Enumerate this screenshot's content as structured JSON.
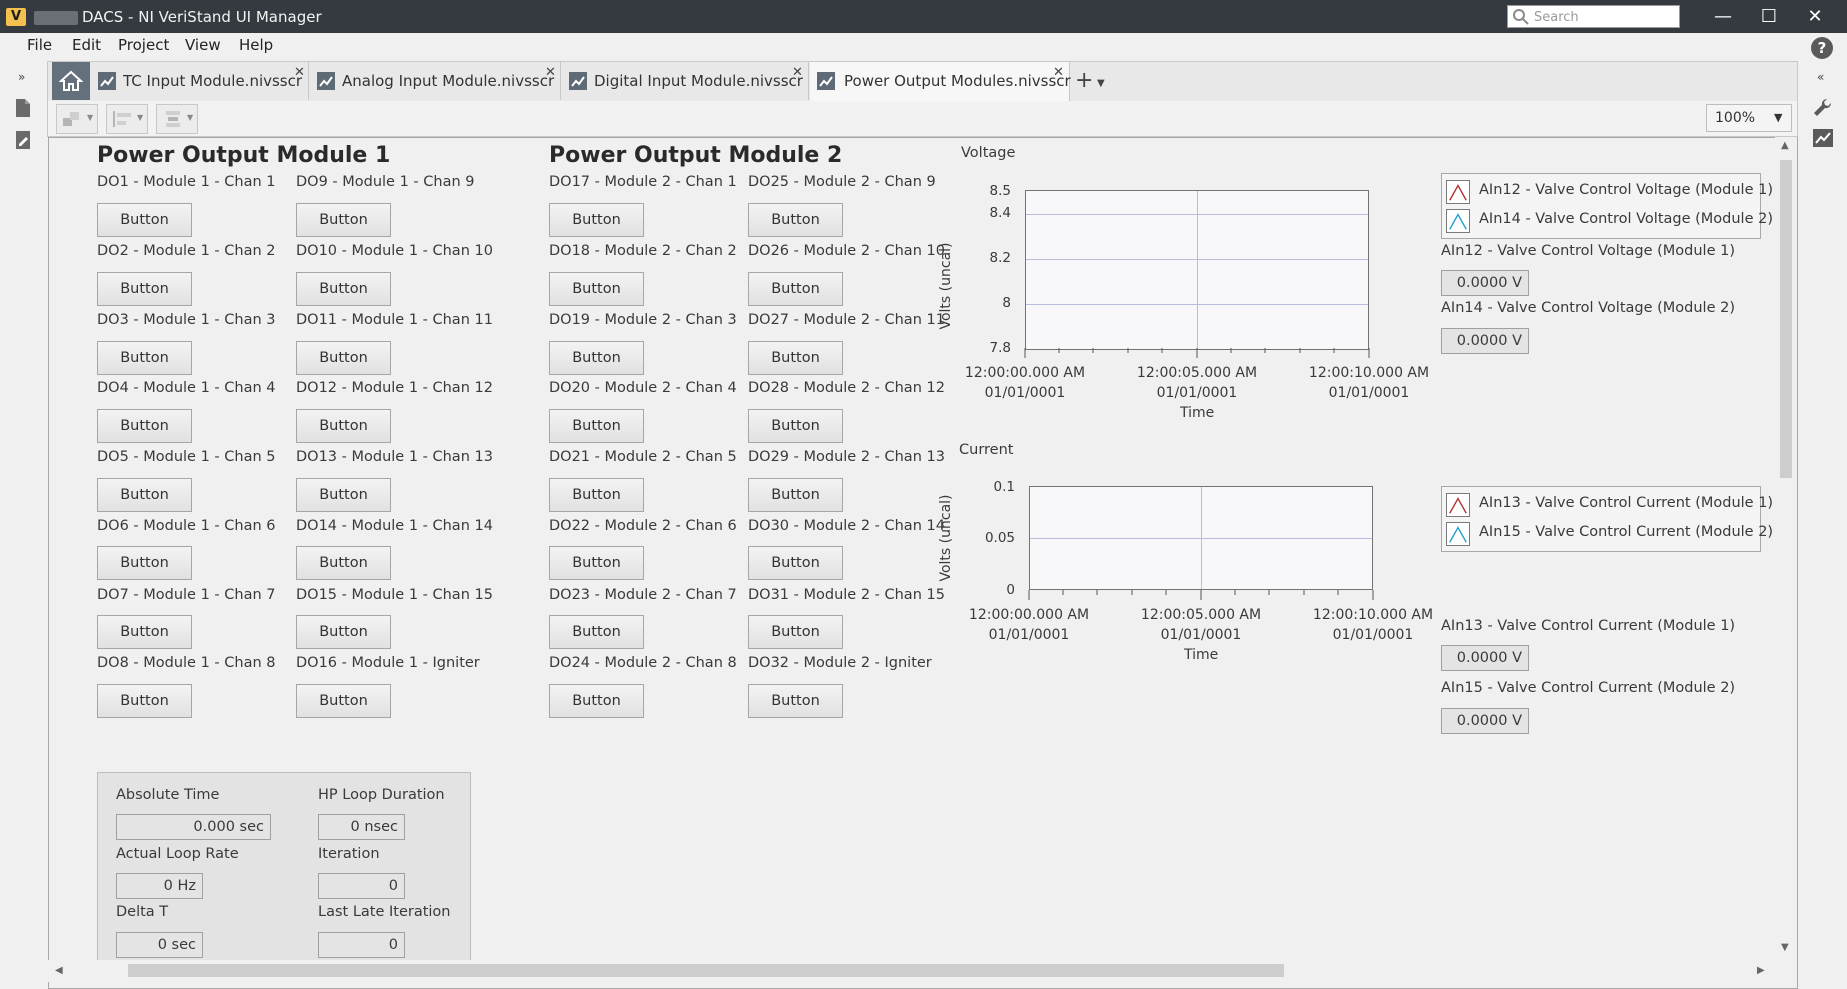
{
  "window": {
    "app_logo": "V",
    "title": "DACS - NI VeriStand UI Manager",
    "search_placeholder": "Search"
  },
  "menu": [
    "File",
    "Edit",
    "Project",
    "View",
    "Help"
  ],
  "tabs": [
    {
      "label": "TC Input Module.nivsscr"
    },
    {
      "label": "Analog Input Module.nivsscr"
    },
    {
      "label": "Digital Input Module.nivsscr"
    },
    {
      "label": "Power Output Modules.nivsscr"
    }
  ],
  "toolbar": {
    "zoom": "100%"
  },
  "module1": {
    "title": "Power Output Module 1",
    "channels": [
      "DO1 - Module 1 - Chan 1",
      "DO2 - Module 1 - Chan 2",
      "DO3 - Module 1 - Chan 3",
      "DO4 - Module 1 - Chan 4",
      "DO5 - Module 1 - Chan 5",
      "DO6 - Module 1 - Chan 6",
      "DO7 - Module 1 - Chan 7",
      "DO8 - Module 1 - Chan 8",
      "DO9 - Module 1 - Chan 9",
      "DO10 - Module 1 - Chan 10",
      "DO11 - Module 1 - Chan 11",
      "DO12 - Module 1 - Chan 12",
      "DO13 - Module 1 - Chan 13",
      "DO14 - Module 1 - Chan 14",
      "DO15 - Module 1 - Chan 15",
      "DO16 - Module 1 - Igniter"
    ]
  },
  "module2": {
    "title": "Power Output Module 2",
    "channels": [
      "DO17 - Module 2 - Chan 1",
      "DO18 - Module 2 - Chan 2",
      "DO19 - Module 2 - Chan 3",
      "DO20 - Module 2 - Chan 4",
      "DO21 - Module 2 - Chan 5",
      "DO22 - Module 2 - Chan 6",
      "DO23 - Module 2 - Chan 7",
      "DO24 - Module 2 - Chan 8",
      "DO25 - Module 2 - Chan 9",
      "DO26 - Module 2 - Chan 10",
      "DO27 - Module 2 - Chan 11",
      "DO28 - Module 2 - Chan 12",
      "DO29 - Module 2 - Chan 13",
      "DO30 - Module 2 - Chan 14",
      "DO31 - Module 2 - Chan 15",
      "DO32 - Module 2 - Igniter"
    ]
  },
  "button_label": "Button",
  "voltage_chart": {
    "title": "Voltage",
    "ylabel": "Volts (uncal)",
    "yticks": [
      "8.5",
      "8.4",
      "8.2",
      "8",
      "7.8"
    ],
    "xticks": [
      {
        "time": "12:00:00.000 AM",
        "date": "01/01/0001"
      },
      {
        "time": "12:00:05.000 AM",
        "date": "01/01/0001"
      },
      {
        "time": "12:00:10.000 AM",
        "date": "01/01/0001"
      }
    ],
    "xlabel": "Time",
    "legend": [
      "AIn12 - Valve Control Voltage (Module 1)",
      "AIn14 - Valve Control Voltage (Module 2)"
    ],
    "indicators": [
      {
        "label": "AIn12 - Valve Control Voltage (Module 1)",
        "value": "0.0000 V"
      },
      {
        "label": "AIn14 - Valve Control Voltage (Module 2)",
        "value": "0.0000 V"
      }
    ]
  },
  "current_chart": {
    "title": "Current",
    "ylabel": "Volts (uncal)",
    "yticks": [
      "0.1",
      "0.05",
      "0"
    ],
    "xticks": [
      {
        "time": "12:00:00.000 AM",
        "date": "01/01/0001"
      },
      {
        "time": "12:00:05.000 AM",
        "date": "01/01/0001"
      },
      {
        "time": "12:00:10.000 AM",
        "date": "01/01/0001"
      }
    ],
    "xlabel": "Time",
    "legend": [
      "AIn13 - Valve Control Current (Module 1)",
      "AIn15 - Valve Control Current (Module 2)"
    ],
    "indicators": [
      {
        "label": "AIn13 - Valve Control Current (Module 1)",
        "value": "0.0000 V"
      },
      {
        "label": "AIn15 - Valve Control Current (Module 2)",
        "value": "0.0000 V"
      }
    ]
  },
  "stats": {
    "absolute_time": {
      "label": "Absolute Time",
      "value": "0.000 sec"
    },
    "hp_loop_duration": {
      "label": "HP Loop Duration",
      "value": "0 nsec"
    },
    "actual_loop_rate": {
      "label": "Actual Loop Rate",
      "value": "0 Hz"
    },
    "iteration": {
      "label": "Iteration",
      "value": "0"
    },
    "delta_t": {
      "label": "Delta T",
      "value": "0 sec"
    },
    "last_late_iteration": {
      "label": "Last Late Iteration",
      "value": "0"
    }
  },
  "colors": {
    "titlebar": "#343a40",
    "home_tab": "#64707c",
    "legend_series_1": "#b03030",
    "legend_series_2": "#1f9fd0"
  }
}
